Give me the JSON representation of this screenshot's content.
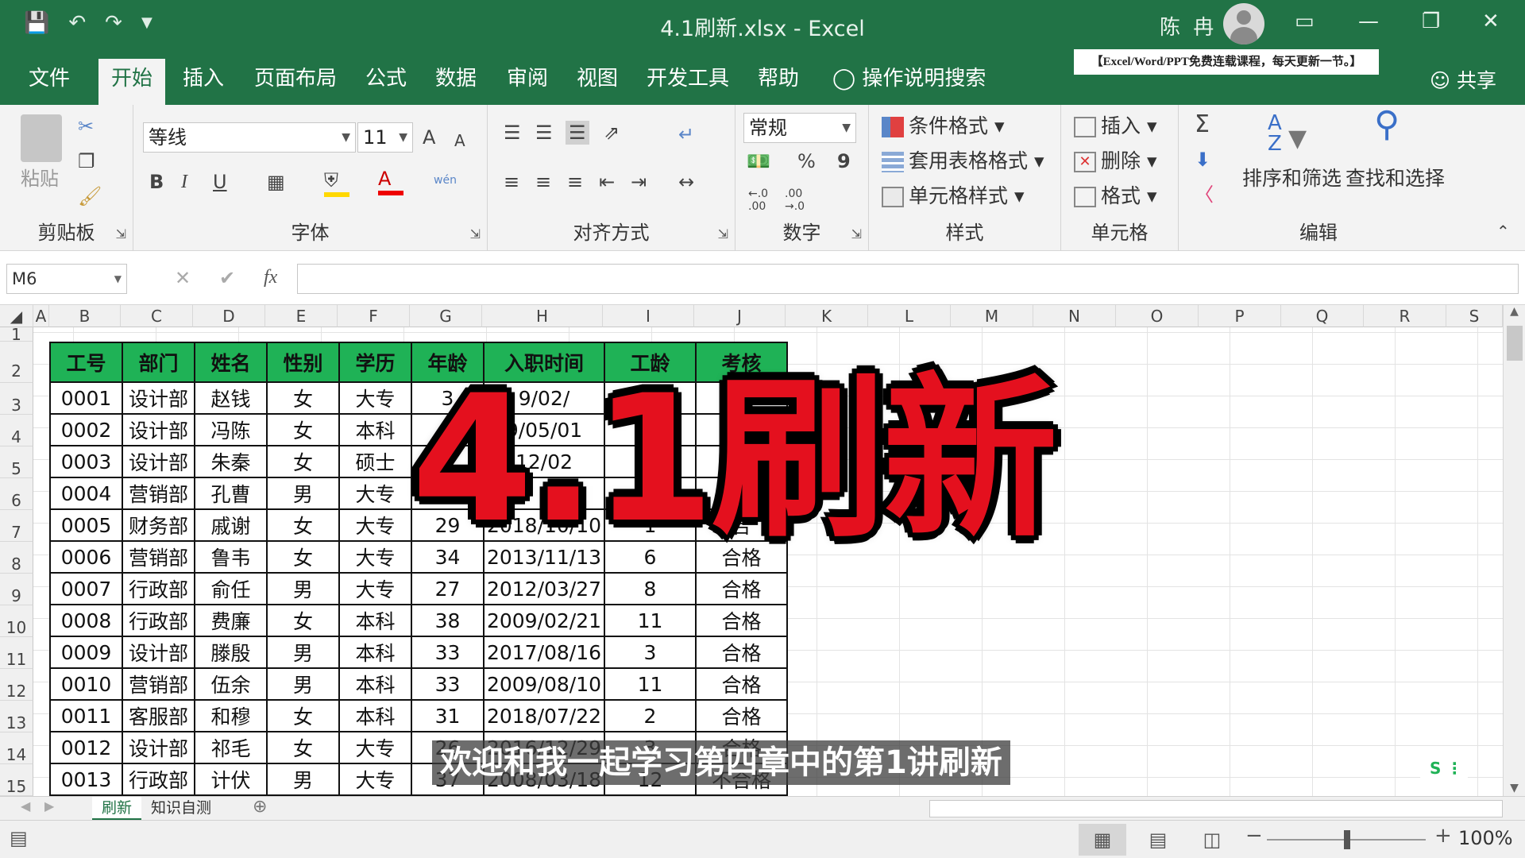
{
  "window": {
    "title": "4.1刷新.xlsx  -  Excel",
    "user": "陈 冉",
    "qat": [
      "save-icon",
      "undo-icon",
      "redo-icon",
      "customize-icon"
    ],
    "controls": {
      "ribbon_display": "▭",
      "minimize": "—",
      "restore": "❐",
      "close": "✕"
    }
  },
  "menu": {
    "tabs": [
      "文件",
      "开始",
      "插入",
      "页面布局",
      "公式",
      "数据",
      "审阅",
      "视图",
      "开发工具",
      "帮助"
    ],
    "active": "开始",
    "tellme": "操作说明搜索",
    "promo": "【Excel/Word/PPT免费连载课程，每天更新一节。】",
    "share": "共享"
  },
  "ribbon": {
    "clipboard": {
      "label": "剪贴板",
      "paste": "粘贴"
    },
    "font": {
      "label": "字体",
      "name": "等线",
      "size": "11",
      "bold": "B",
      "italic": "I",
      "underline": "U",
      "grow": "A",
      "shrink": "A",
      "fontcolor": "A",
      "phonetic": "wén"
    },
    "alignment": {
      "label": "对齐方式"
    },
    "number": {
      "label": "数字",
      "format": "常规",
      "percent": "%",
      "comma": "9",
      "inc": "←.0\n.00",
      "dec": ".00\n→.0"
    },
    "styles": {
      "label": "样式",
      "conditional": "条件格式",
      "table": "套用表格格式",
      "cell": "单元格样式"
    },
    "cells": {
      "label": "单元格",
      "insert": "插入",
      "delete": "删除",
      "format": "格式"
    },
    "editing": {
      "label": "编辑",
      "sort": "排序和筛选",
      "find": "查找和选择",
      "sum": "Σ"
    }
  },
  "formula": {
    "namebox": "M6",
    "cancel": "✕",
    "enter": "✔",
    "fx": "fx"
  },
  "columns": [
    "A",
    "B",
    "C",
    "D",
    "E",
    "F",
    "G",
    "H",
    "I",
    "J",
    "K",
    "L",
    "M",
    "N",
    "O",
    "P",
    "Q",
    "R",
    "S"
  ],
  "rows": [
    "1",
    "2",
    "3",
    "4",
    "5",
    "6",
    "7",
    "8",
    "9",
    "10",
    "11",
    "12",
    "13",
    "14",
    "15"
  ],
  "table": {
    "headers": [
      "工号",
      "部门",
      "姓名",
      "性别",
      "学历",
      "年龄",
      "入职时间",
      "工龄",
      "考核"
    ],
    "rows": [
      [
        "0001",
        "设计部",
        "赵钱",
        "女",
        "大专",
        "3",
        "9/02/",
        "",
        ""
      ],
      [
        "0002",
        "设计部",
        "冯陈",
        "女",
        "本科",
        "",
        "9/05/01",
        "",
        ""
      ],
      [
        "0003",
        "设计部",
        "朱秦",
        "女",
        "硕士",
        "",
        "12/02",
        "",
        ""
      ],
      [
        "0004",
        "营销部",
        "孔曹",
        "男",
        "大专",
        "2",
        "",
        "",
        ""
      ],
      [
        "0005",
        "财务部",
        "戚谢",
        "女",
        "大专",
        "29",
        "2018/10/10",
        "1",
        "合"
      ],
      [
        "0006",
        "营销部",
        "鲁韦",
        "女",
        "大专",
        "34",
        "2013/11/13",
        "6",
        "合格"
      ],
      [
        "0007",
        "行政部",
        "俞任",
        "男",
        "大专",
        "27",
        "2012/03/27",
        "8",
        "合格"
      ],
      [
        "0008",
        "行政部",
        "费廉",
        "女",
        "本科",
        "38",
        "2009/02/21",
        "11",
        "合格"
      ],
      [
        "0009",
        "设计部",
        "滕殷",
        "男",
        "本科",
        "33",
        "2017/08/16",
        "3",
        "合格"
      ],
      [
        "0010",
        "营销部",
        "伍余",
        "男",
        "本科",
        "33",
        "2009/08/10",
        "11",
        "合格"
      ],
      [
        "0011",
        "客服部",
        "和穆",
        "女",
        "本科",
        "31",
        "2018/07/22",
        "2",
        "合格"
      ],
      [
        "0012",
        "设计部",
        "祁毛",
        "女",
        "大专",
        "26",
        "2016/12/29",
        "3",
        "合格"
      ],
      [
        "0013",
        "行政部",
        "计伏",
        "男",
        "大专",
        "37",
        "2008/03/18",
        "12",
        "不合格"
      ]
    ]
  },
  "overlay": {
    "title": "4.1刷新",
    "subtitle": "欢迎和我一起学习第四章中的第1讲刷新"
  },
  "sheets": {
    "tabs": [
      "刷新",
      "知识自测"
    ],
    "active": "刷新",
    "add": "⊕"
  },
  "status": {
    "zoom": "100%",
    "minus": "−",
    "plus": "+"
  }
}
